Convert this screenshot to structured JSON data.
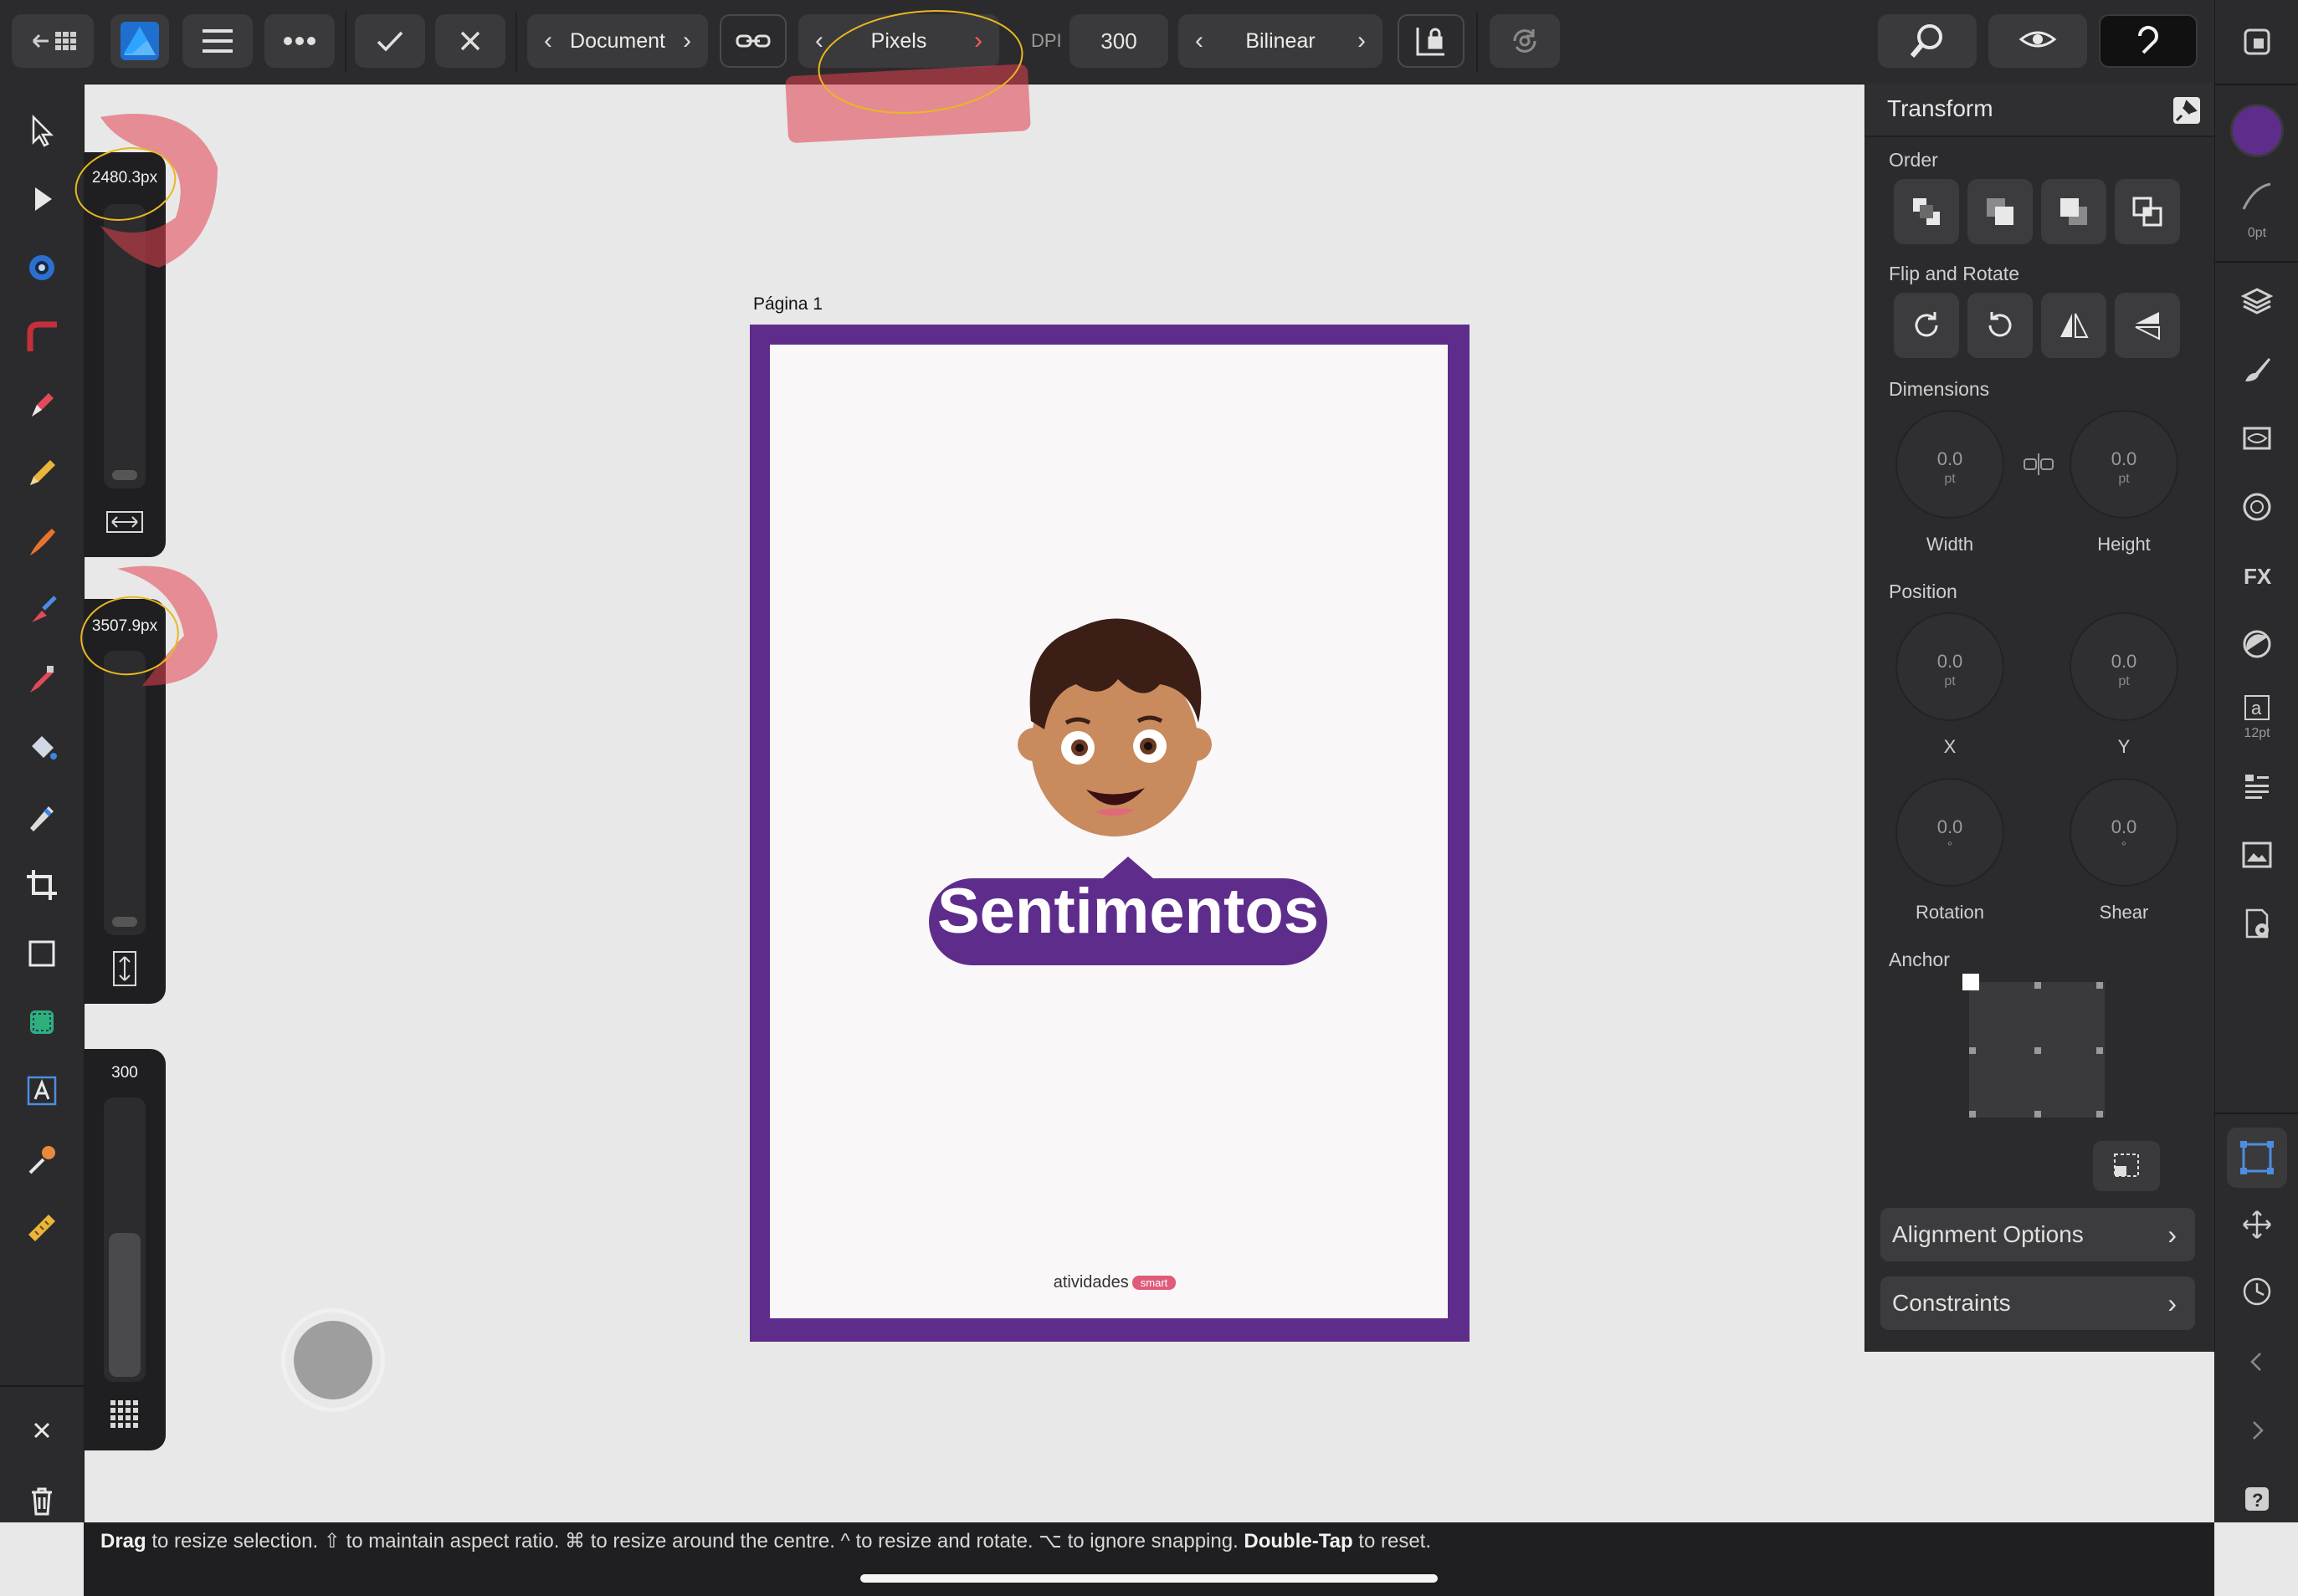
{
  "toolbar": {
    "persona_label": "Document",
    "units_label": "Pixels",
    "dpi_label": "DPI",
    "dpi_value": "300",
    "resample_label": "Bilinear"
  },
  "sliders": {
    "width_value": "2480.3px",
    "height_value": "3507.9px",
    "dpi_value": "300"
  },
  "canvas": {
    "page_label": "Página 1",
    "headline": "Sentimentos",
    "brand_main": "atividades",
    "brand_tag": "smart"
  },
  "transform_panel": {
    "title": "Transform",
    "order_label": "Order",
    "flip_rotate_label": "Flip and Rotate",
    "dimensions_label": "Dimensions",
    "width_value": "0.0",
    "width_unit": "pt",
    "width_caption": "Width",
    "height_value": "0.0",
    "height_unit": "pt",
    "height_caption": "Height",
    "position_label": "Position",
    "x_value": "0.0",
    "x_unit": "pt",
    "x_caption": "X",
    "y_value": "0.0",
    "y_unit": "pt",
    "y_caption": "Y",
    "rotation_value": "0.0",
    "rotation_unit": "°",
    "rotation_caption": "Rotation",
    "shear_value": "0.0",
    "shear_unit": "°",
    "shear_caption": "Shear",
    "anchor_label": "Anchor",
    "alignment_options_label": "Alignment Options",
    "constraints_label": "Constraints"
  },
  "studio": {
    "stroke_width_label": "0pt",
    "text_size_label": "12pt",
    "fill_color": "#5e2d8c",
    "text_icon_glyph": "a"
  },
  "status": {
    "drag": "Drag",
    "drag_text": " to resize selection. ⇧ to maintain aspect ratio. ⌘ to resize around the centre. ^ to resize and rotate. ⌥ to ignore snapping. ",
    "double_tap": "Double-Tap",
    "double_tap_text": " to reset."
  },
  "colors": {
    "accent_purple": "#5e2d8c",
    "app_blue": "#2d8fe3",
    "brand_pink": "#e05a7a"
  }
}
